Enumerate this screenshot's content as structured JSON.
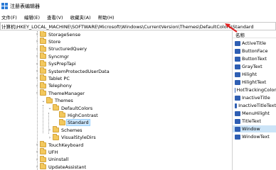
{
  "window": {
    "title": "注册表编辑器"
  },
  "menu": [
    "文件(F)",
    "编辑(E)",
    "查看(V)",
    "收藏夹(A)",
    "帮助(H)"
  ],
  "address": {
    "path": "计算机\\HKEY_LOCAL_MACHINE\\SOFTWARE\\Microsoft\\Windows\\CurrentVersion\\Themes\\DefaultColors\\Standard"
  },
  "tree": {
    "items": [
      {
        "label": "StorageSense",
        "expanded": false,
        "selected": false
      },
      {
        "label": "Store",
        "expanded": false,
        "selected": false
      },
      {
        "label": "StructuredQuery",
        "expanded": false,
        "selected": false
      },
      {
        "label": "Syncmgr",
        "expanded": false,
        "selected": false
      },
      {
        "label": "SysPrepTapi",
        "expanded": false,
        "selected": false
      },
      {
        "label": "SystemProtectedUserData",
        "expanded": false,
        "selected": false
      },
      {
        "label": "Tablet PC",
        "expanded": false,
        "selected": false
      },
      {
        "label": "Telephony",
        "expanded": false,
        "selected": false
      },
      {
        "label": "ThemeManager",
        "expanded": false,
        "selected": false
      },
      {
        "label": "Themes",
        "expanded": true,
        "selected": false
      },
      {
        "label": "DefaultColors",
        "expanded": true,
        "selected": false
      },
      {
        "label": "HighContrast",
        "expanded": false,
        "selected": false
      },
      {
        "label": "Standard",
        "expanded": false,
        "selected": true
      },
      {
        "label": "Schemes",
        "expanded": false,
        "selected": false
      },
      {
        "label": "VisualStyleDirs",
        "expanded": false,
        "selected": false
      },
      {
        "label": "TouchKeyboard",
        "expanded": false,
        "selected": false
      },
      {
        "label": "UFH",
        "expanded": false,
        "selected": false
      },
      {
        "label": "Uninstall",
        "expanded": false,
        "selected": false
      },
      {
        "label": "UpdateAssistant",
        "expanded": false,
        "selected": false
      }
    ]
  },
  "values": {
    "header": "名称",
    "items": [
      {
        "label": "ActiveTitle",
        "icon": "reg-dword-icon"
      },
      {
        "label": "ButtonFace",
        "icon": "reg-dword-icon"
      },
      {
        "label": "ButtonText",
        "icon": "reg-dword-icon"
      },
      {
        "label": "GrayText",
        "icon": "reg-dword-icon"
      },
      {
        "label": "Hilight",
        "icon": "reg-dword-icon"
      },
      {
        "label": "HilightText",
        "icon": "reg-dword-icon"
      },
      {
        "label": "HotTrackingColor",
        "icon": "reg-dword-icon"
      },
      {
        "label": "InactiveTitle",
        "icon": "reg-dword-icon"
      },
      {
        "label": "InactiveTitleText",
        "icon": "reg-dword-icon"
      },
      {
        "label": "MenuHilight",
        "icon": "reg-dword-icon"
      },
      {
        "label": "TitleText",
        "icon": "reg-dword-icon"
      },
      {
        "label": "Window",
        "icon": "reg-dword-icon",
        "selected": true
      },
      {
        "label": "WindowText",
        "icon": "reg-dword-icon"
      }
    ]
  },
  "colors": {
    "arrow": "#e02020",
    "selection": "#cce4f7",
    "folder": "#f3c85d"
  }
}
